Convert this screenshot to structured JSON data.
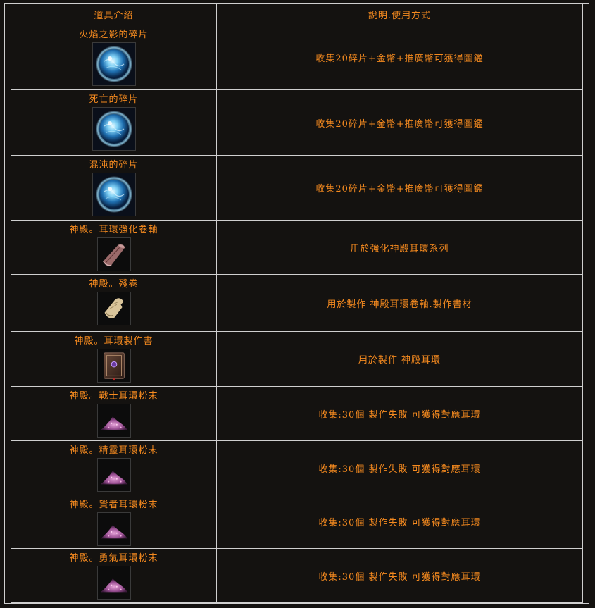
{
  "header": {
    "col1": "道具介紹",
    "col2": "說明.使用方式"
  },
  "rows": [
    {
      "name": "火焰之影的碎片",
      "icon": "shard-orb-icon",
      "desc": "收集20碎片+金幣+推廣幣可獲得圖鑑"
    },
    {
      "name": "死亡的碎片",
      "icon": "shard-orb-icon",
      "desc": "收集20碎片+金幣+推廣幣可獲得圖鑑"
    },
    {
      "name": "混沌的碎片",
      "icon": "shard-orb-icon",
      "desc": "收集20碎片+金幣+推廣幣可獲得圖鑑"
    },
    {
      "name": "神殿。耳環強化卷軸",
      "icon": "scroll-icon",
      "desc": "用於強化神殿耳環系列"
    },
    {
      "name": "神殿。殘卷",
      "icon": "torn-scroll-icon",
      "desc": "用於製作 神殿耳環卷軸.製作書材"
    },
    {
      "name": "神殿。耳環製作書",
      "icon": "book-icon",
      "desc": "用於製作 神殿耳環"
    },
    {
      "name": "神殿。戰士耳環粉末",
      "icon": "powder-icon",
      "desc": "收集:30個 製作失敗 可獲得對應耳環"
    },
    {
      "name": "神殿。精靈耳環粉末",
      "icon": "powder-icon",
      "desc": "收集:30個 製作失敗 可獲得對應耳環"
    },
    {
      "name": "神殿。賢者耳環粉末",
      "icon": "powder-icon",
      "desc": "收集:30個 製作失敗 可獲得對應耳環"
    },
    {
      "name": "神殿。勇氣耳環粉末",
      "icon": "powder-icon",
      "desc": "收集:30個 製作失敗 可獲得對應耳環"
    }
  ]
}
